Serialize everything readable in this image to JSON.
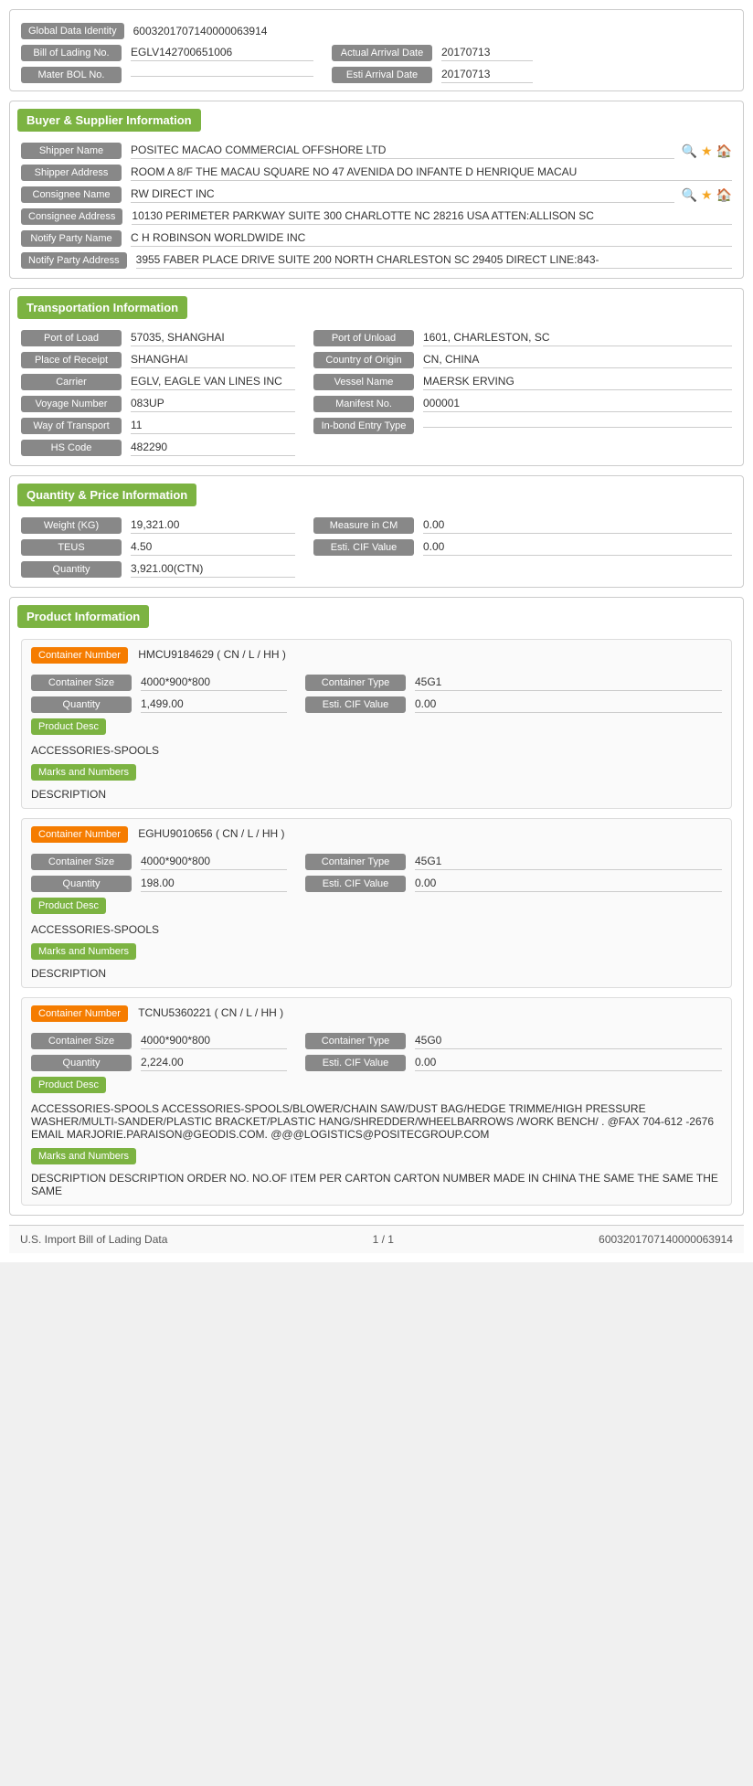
{
  "global": {
    "label": "Global Data Identity",
    "value": "6003201707140000063914"
  },
  "header": {
    "bol_label": "Bill of Lading No.",
    "bol_value": "EGLV142700651006",
    "actual_arrival_label": "Actual Arrival Date",
    "actual_arrival_value": "20170713",
    "master_bol_label": "Mater BOL No.",
    "master_bol_value": "",
    "esti_arrival_label": "Esti Arrival Date",
    "esti_arrival_value": "20170713"
  },
  "buyer_supplier": {
    "title": "Buyer & Supplier Information",
    "shipper_name_label": "Shipper Name",
    "shipper_name_value": "POSITEC MACAO COMMERCIAL OFFSHORE LTD",
    "shipper_address_label": "Shipper Address",
    "shipper_address_value": "ROOM A 8/F THE MACAU SQUARE NO 47 AVENIDA DO INFANTE D HENRIQUE MACAU",
    "consignee_name_label": "Consignee Name",
    "consignee_name_value": "RW DIRECT INC",
    "consignee_address_label": "Consignee Address",
    "consignee_address_value": "10130 PERIMETER PARKWAY SUITE 300 CHARLOTTE NC 28216 USA ATTEN:ALLISON SC",
    "notify_party_name_label": "Notify Party Name",
    "notify_party_name_value": "C H ROBINSON WORLDWIDE INC",
    "notify_party_address_label": "Notify Party Address",
    "notify_party_address_value": "3955 FABER PLACE DRIVE SUITE 200 NORTH CHARLESTON SC 29405 DIRECT LINE:843-"
  },
  "transportation": {
    "title": "Transportation Information",
    "port_of_load_label": "Port of Load",
    "port_of_load_value": "57035, SHANGHAI",
    "port_of_unload_label": "Port of Unload",
    "port_of_unload_value": "1601, CHARLESTON, SC",
    "place_of_receipt_label": "Place of Receipt",
    "place_of_receipt_value": "SHANGHAI",
    "country_of_origin_label": "Country of Origin",
    "country_of_origin_value": "CN, CHINA",
    "carrier_label": "Carrier",
    "carrier_value": "EGLV, EAGLE VAN LINES INC",
    "vessel_name_label": "Vessel Name",
    "vessel_name_value": "MAERSK ERVING",
    "voyage_number_label": "Voyage Number",
    "voyage_number_value": "083UP",
    "manifest_no_label": "Manifest No.",
    "manifest_no_value": "000001",
    "way_of_transport_label": "Way of Transport",
    "way_of_transport_value": "11",
    "in_bond_label": "In-bond Entry Type",
    "in_bond_value": "",
    "hs_code_label": "HS Code",
    "hs_code_value": "482290"
  },
  "quantity_price": {
    "title": "Quantity & Price Information",
    "weight_label": "Weight (KG)",
    "weight_value": "19,321.00",
    "measure_cm_label": "Measure in CM",
    "measure_cm_value": "0.00",
    "teus_label": "TEUS",
    "teus_value": "4.50",
    "esti_cif_label": "Esti. CIF Value",
    "esti_cif_value": "0.00",
    "quantity_label": "Quantity",
    "quantity_value": "3,921.00(CTN)"
  },
  "product_info": {
    "title": "Product Information",
    "containers": [
      {
        "container_number_label": "Container Number",
        "container_number_value": "HMCU9184629 ( CN / L / HH )",
        "container_size_label": "Container Size",
        "container_size_value": "4000*900*800",
        "container_type_label": "Container Type",
        "container_type_value": "45G1",
        "quantity_label": "Quantity",
        "quantity_value": "1,499.00",
        "esti_cif_label": "Esti. CIF Value",
        "esti_cif_value": "0.00",
        "product_desc_label": "Product Desc",
        "product_desc_value": "ACCESSORIES-SPOOLS",
        "marks_label": "Marks and Numbers",
        "marks_value": "DESCRIPTION"
      },
      {
        "container_number_label": "Container Number",
        "container_number_value": "EGHU9010656 ( CN / L / HH )",
        "container_size_label": "Container Size",
        "container_size_value": "4000*900*800",
        "container_type_label": "Container Type",
        "container_type_value": "45G1",
        "quantity_label": "Quantity",
        "quantity_value": "198.00",
        "esti_cif_label": "Esti. CIF Value",
        "esti_cif_value": "0.00",
        "product_desc_label": "Product Desc",
        "product_desc_value": "ACCESSORIES-SPOOLS",
        "marks_label": "Marks and Numbers",
        "marks_value": "DESCRIPTION"
      },
      {
        "container_number_label": "Container Number",
        "container_number_value": "TCNU5360221 ( CN / L / HH )",
        "container_size_label": "Container Size",
        "container_size_value": "4000*900*800",
        "container_type_label": "Container Type",
        "container_type_value": "45G0",
        "quantity_label": "Quantity",
        "quantity_value": "2,224.00",
        "esti_cif_label": "Esti. CIF Value",
        "esti_cif_value": "0.00",
        "product_desc_label": "Product Desc",
        "product_desc_value": "ACCESSORIES-SPOOLS ACCESSORIES-SPOOLS/BLOWER/CHAIN SAW/DUST BAG/HEDGE TRIMME/HIGH PRESSURE WASHER/MULTI-SANDER/PLASTIC BRACKET/PLASTIC HANG/SHREDDER/WHEELBARROWS /WORK BENCH/ . @FAX 704-612 -2676 EMAIL MARJORIE.PARAISON@GEODIS.COM. @@@LOGISTICS@POSITECGROUP.COM",
        "marks_label": "Marks and Numbers",
        "marks_value": "DESCRIPTION DESCRIPTION ORDER NO. NO.OF ITEM PER CARTON CARTON NUMBER MADE IN CHINA THE SAME THE SAME THE SAME"
      }
    ]
  },
  "footer": {
    "left": "U.S. Import Bill of Lading Data",
    "center": "1 / 1",
    "right": "6003201707140000063914"
  }
}
